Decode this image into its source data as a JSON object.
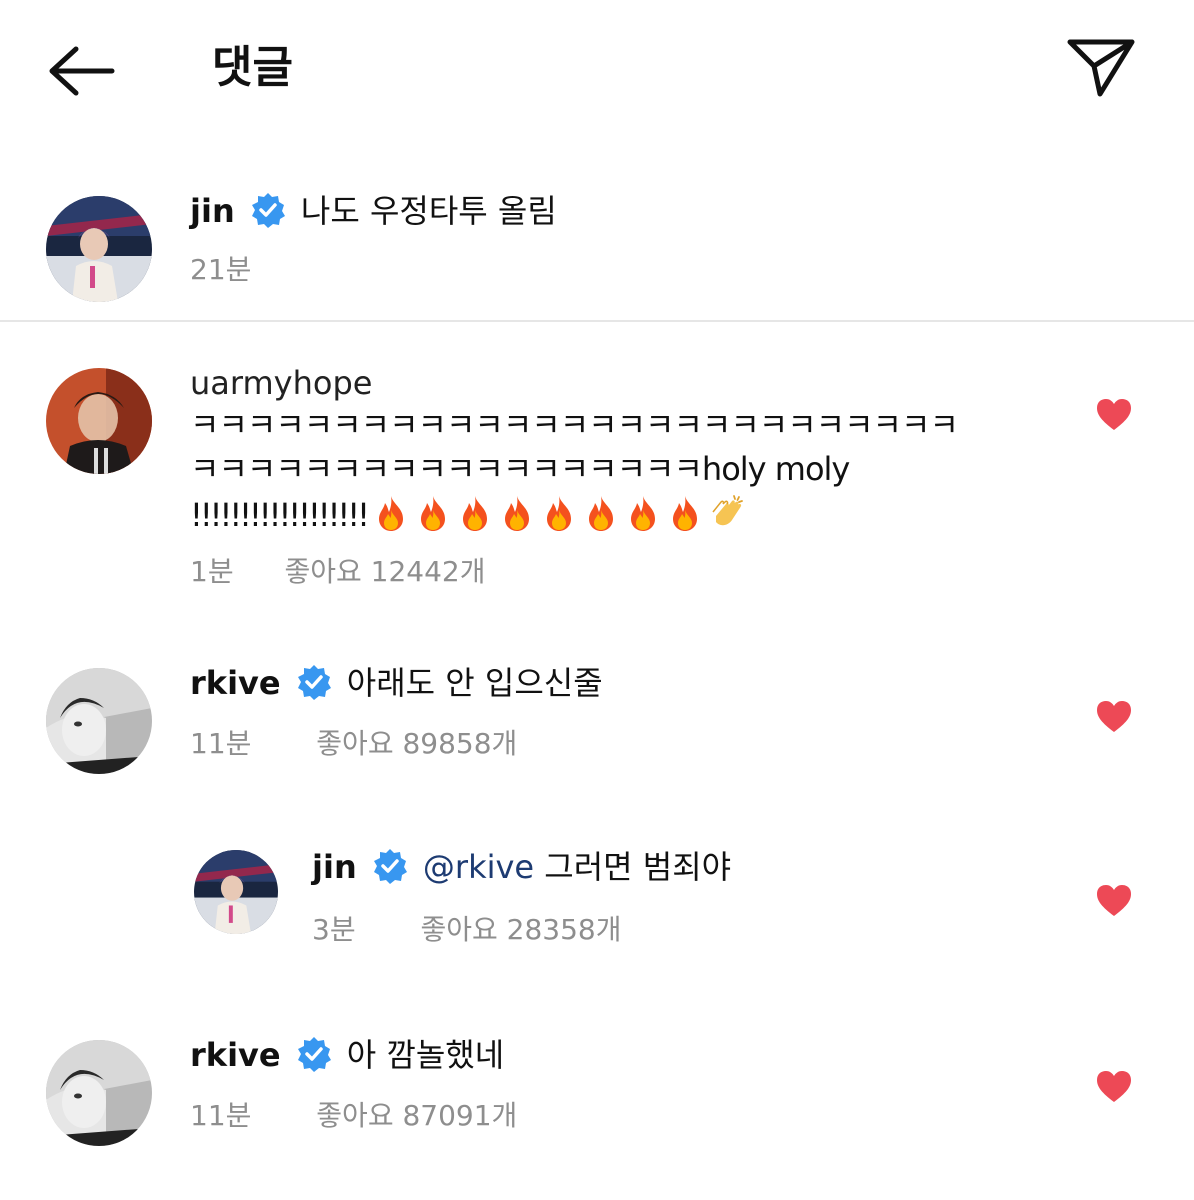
{
  "header": {
    "title": "댓글",
    "back_icon": "arrow-left-icon",
    "send_icon": "paper-plane-icon"
  },
  "caption": {
    "username": "jin",
    "verified": true,
    "text": "나도 우정타투 올림",
    "time": "21분"
  },
  "comments": [
    {
      "username": "uarmyhope",
      "verified": false,
      "text_line1": "ㅋㅋㅋㅋㅋㅋㅋㅋㅋㅋㅋㅋㅋㅋㅋㅋㅋㅋㅋㅋㅋㅋㅋㅋㅋㅋㅋ",
      "text_line2": "ㅋㅋㅋㅋㅋㅋㅋㅋㅋㅋㅋㅋㅋㅋㅋㅋㅋㅋholy moly",
      "text_line3": "!!!!!!!!!!!!!!!!!!",
      "emojis": [
        "fire-icon",
        "fire-icon",
        "fire-icon",
        "fire-icon",
        "fire-icon",
        "fire-icon",
        "fire-icon",
        "fire-icon",
        "clapping-hands-icon"
      ],
      "time": "1분",
      "likes": "좋아요 12442개",
      "liked": true
    },
    {
      "username": "rkive",
      "verified": true,
      "text": "아래도 안 입으신줄",
      "time": "11분",
      "likes": "좋아요 89858개",
      "liked": true
    },
    {
      "username": "jin",
      "verified": true,
      "reply": true,
      "mention": "@rkive",
      "text": " 그러면 범죄야",
      "time": "3분",
      "likes": "좋아요 28358개",
      "liked": true
    },
    {
      "username": "rkive",
      "verified": true,
      "text": "아 깜놀했네",
      "time": "11분",
      "likes": "좋아요 87091개",
      "liked": true
    }
  ],
  "colors": {
    "heart": "#ed4956",
    "verified": "#3897f0",
    "meta": "#8e8e8e",
    "mention": "#1d3b72",
    "divider": "#e6e6e6"
  }
}
